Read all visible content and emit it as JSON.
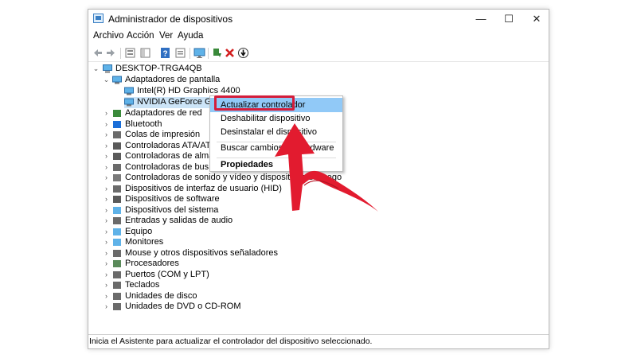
{
  "window": {
    "title": "Administrador de dispositivos",
    "minimize_glyph": "—",
    "maximize_glyph": "☐",
    "close_glyph": "✕"
  },
  "menu": [
    "Archivo",
    "Acción",
    "Ver",
    "Ayuda"
  ],
  "toolbar_icons": [
    "back-arrow-icon",
    "forward-arrow-icon",
    "properties-icon",
    "console-tree-icon",
    "help-icon",
    "view-icon",
    "monitor-icon",
    "update-driver-icon",
    "uninstall-icon",
    "download-icon"
  ],
  "tree": {
    "root": "DESKTOP-TRGA4QB",
    "display_adapters": {
      "label": "Adaptadores de pantalla",
      "children": [
        "Intel(R) HD Graphics 4400",
        "NVIDIA GeForce GTX 1050 Ti"
      ]
    },
    "categories": [
      "Adaptadores de red",
      "Bluetooth",
      "Colas de impresión",
      "Controladoras ATA/ATAPI IDE",
      "Controladoras de almacenamiento",
      "Controladoras de bus serie universal",
      "Controladoras de sonido y vídeo y dispositivos de juego",
      "Dispositivos de interfaz de usuario (HID)",
      "Dispositivos de software",
      "Dispositivos del sistema",
      "Entradas y salidas de audio",
      "Equipo",
      "Monitores",
      "Mouse y otros dispositivos señaladores",
      "Procesadores",
      "Puertos (COM y LPT)",
      "Teclados",
      "Unidades de disco",
      "Unidades de DVD o CD-ROM"
    ]
  },
  "context_menu": {
    "items": [
      "Actualizar controlador",
      "Deshabilitar dispositivo",
      "Desinstalar el dispositivo",
      "Buscar cambios de hardware",
      "Propiedades"
    ],
    "highlighted": "Actualizar controlador",
    "highlight_color": "#91c9f7"
  },
  "status_bar": "Inicia el Asistente para actualizar el controlador del dispositivo seleccionado.",
  "colors": {
    "annotation_red": "#d41d3b",
    "selection_blue": "#91c9f7"
  }
}
